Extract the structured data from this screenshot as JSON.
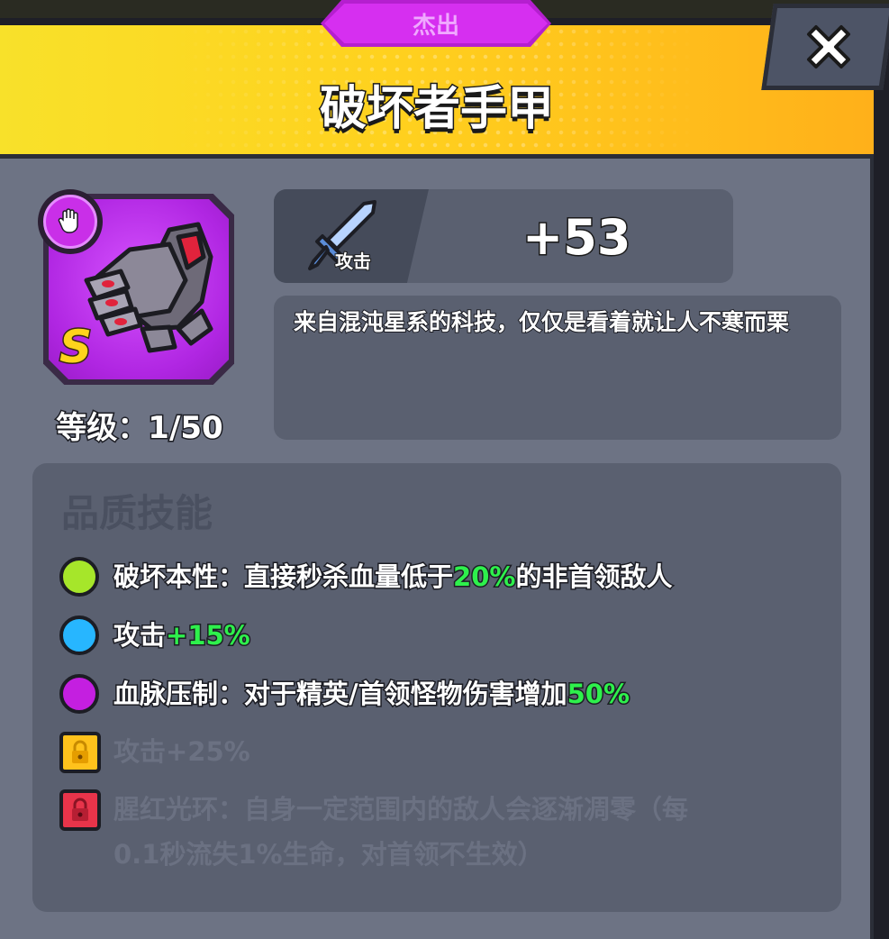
{
  "rarity": "杰出",
  "item_name": "破坏者手甲",
  "close_icon": "close-icon",
  "item": {
    "grade": "S",
    "level_text": "等级：1/50",
    "icon_color": "#b026e2",
    "badge_icon": "glove-icon"
  },
  "stat": {
    "label": "攻击",
    "value": "+53",
    "icon": "sword-icon"
  },
  "description": "来自混沌星系的科技，仅仅是看着就让人不寒而栗",
  "skills": {
    "title": "品质技能",
    "items": [
      {
        "prefix": "破坏本性：直接秒杀血量低于",
        "highlight": "20%",
        "suffix": "的非首领敌人",
        "dot_color": "#a6e62a",
        "locked": false
      },
      {
        "prefix": "攻击",
        "highlight": "+15%",
        "suffix": "",
        "dot_color": "#27b6ff",
        "locked": false
      },
      {
        "prefix": "血脉压制：对于精英/首领怪物伤害增加",
        "highlight": "50%",
        "suffix": "",
        "dot_color": "#c41fe0",
        "locked": false
      },
      {
        "text": "攻击+25%",
        "lock_color": "#ffc21c",
        "locked": true
      },
      {
        "text_line1": "腥红光环：自身一定范围内的敌人会逐渐凋零（每",
        "text_line2": "0.1秒流失1%生命，对首领不生效）",
        "lock_color": "#e8344a",
        "locked": true
      }
    ]
  },
  "colors": {
    "header_yellow": "#ffd11e",
    "rarity_purple": "#d62ff0",
    "highlight_green": "#2ef04c",
    "panel_gray": "#6d7384"
  }
}
